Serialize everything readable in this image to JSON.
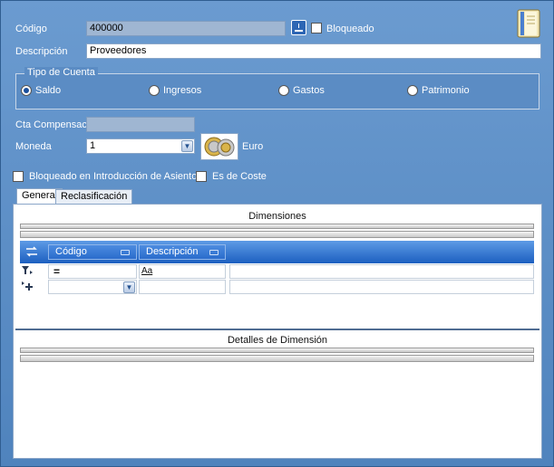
{
  "form": {
    "codigo_label": "Código",
    "codigo_value": "400000",
    "bloqueado_label": "Bloqueado",
    "descripcion_label": "Descripción",
    "descripcion_value": "Proveedores",
    "tipo_cuenta_title": "Tipo de Cuenta",
    "tipo_options": [
      "Saldo",
      "Ingresos",
      "Gastos",
      "Patrimonio"
    ],
    "tipo_selected": "Saldo",
    "cta_compensacion_label": "Cta Compensación",
    "cta_compensacion_value": "",
    "moneda_label": "Moneda",
    "moneda_value": "1",
    "moneda_currency": "Euro",
    "bloqueado_intro_label": "Bloqueado en Introducción de Asientos",
    "es_de_coste_label": "Es de Coste"
  },
  "tabs": [
    "General",
    "Reclasificación"
  ],
  "dimensiones": {
    "title": "Dimensiones",
    "columns": [
      "Código",
      "Descripción"
    ],
    "filter_operator": "=",
    "filter_text_icon": "Aa"
  },
  "detalles": {
    "title": "Detalles de Dimensión"
  },
  "icons": {
    "save": "floppy-disk-icon",
    "book": "book-icon",
    "coins": "euro-coins-icon"
  },
  "colors": {
    "window_bg": "#5b8cc4",
    "grid_header": "#1c5fc0"
  }
}
